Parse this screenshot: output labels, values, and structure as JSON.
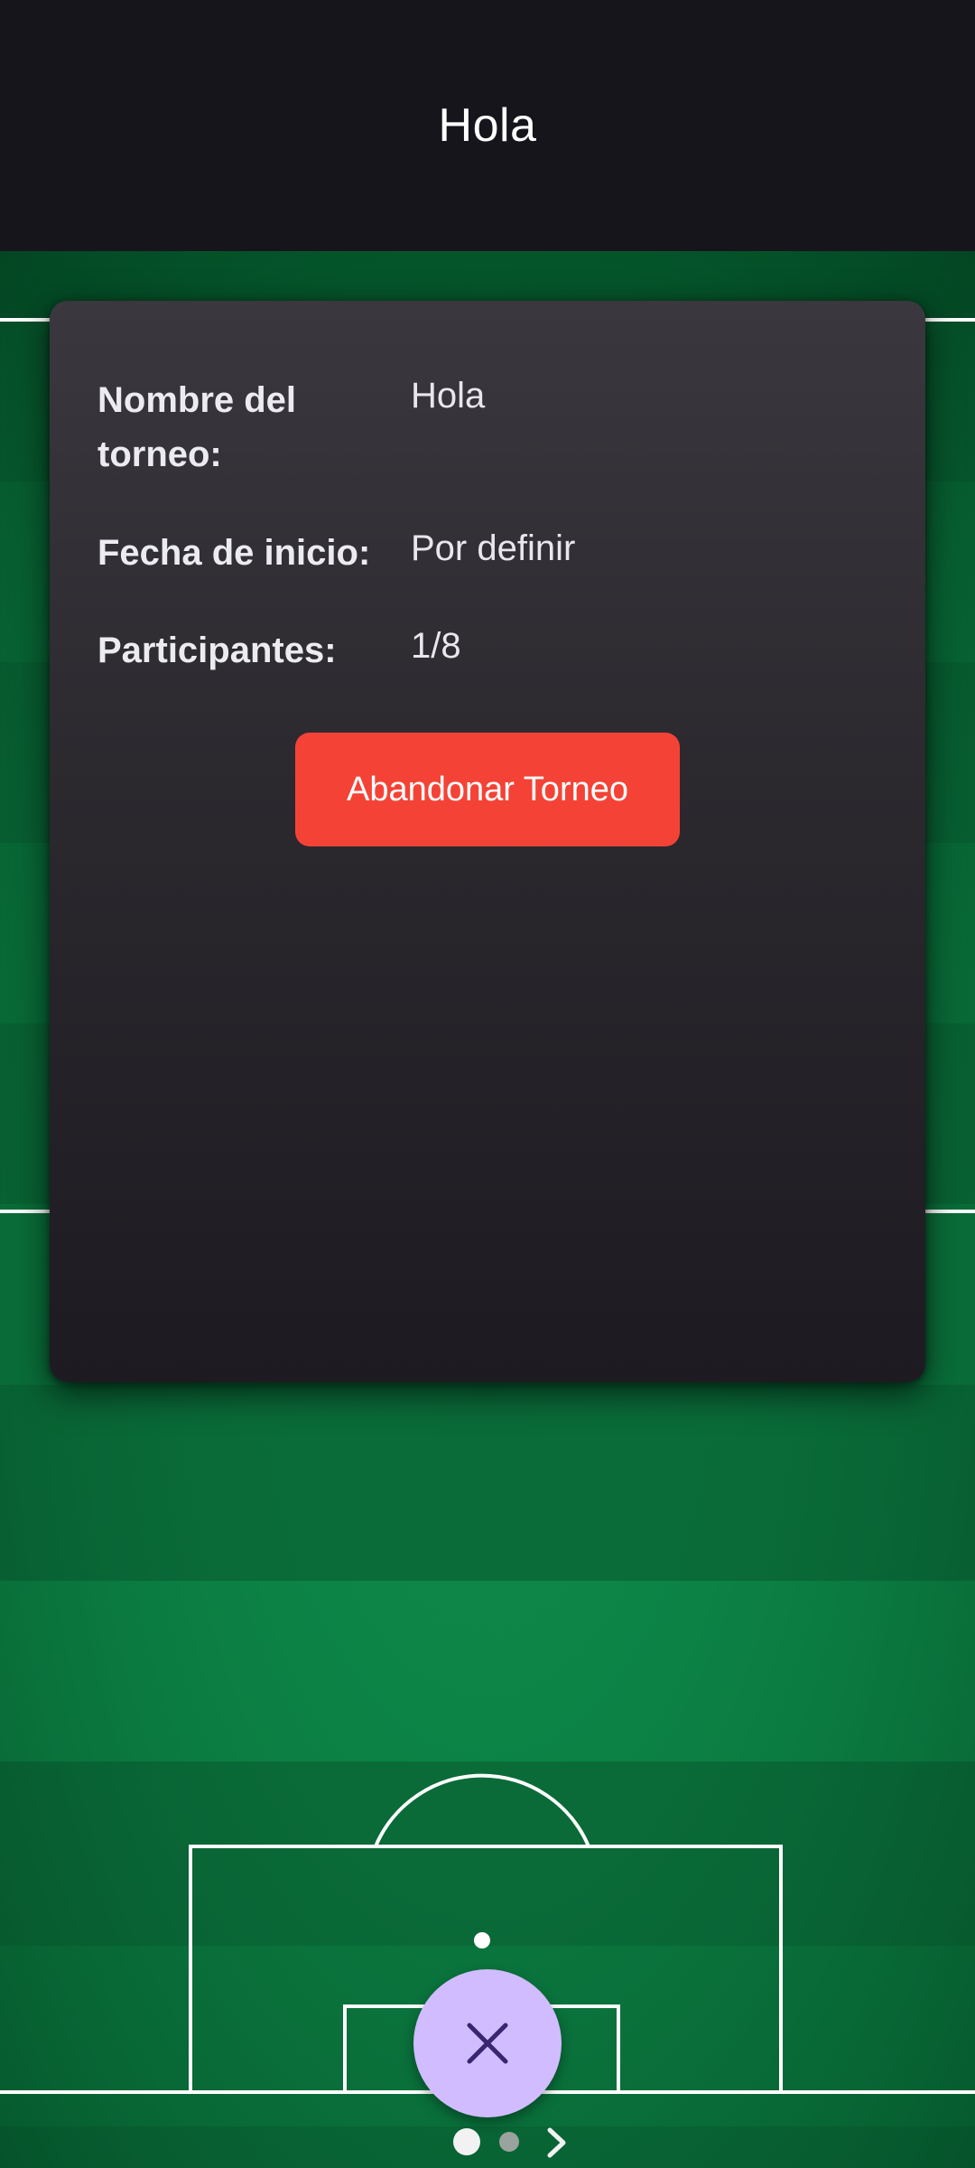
{
  "app_bar": {
    "title": "Hola"
  },
  "card": {
    "rows": [
      {
        "label": "Nombre del torneo:",
        "value": "Hola"
      },
      {
        "label": "Fecha de inicio:",
        "value": "Por definir"
      },
      {
        "label": "Participantes:",
        "value": "1/8"
      }
    ],
    "leave_button_label": "Abandonar Torneo"
  },
  "fab": {
    "icon": "close-icon"
  },
  "pager": {
    "pages": 2,
    "current_page": 1,
    "next_icon": "chevron-right-icon"
  },
  "colors": {
    "background": "#17151c",
    "field_green": "#0b6b3a",
    "card": "#2b292e",
    "danger_button": "#f44336",
    "fab": "#d0bcff",
    "fab_icon": "#3a2570"
  }
}
